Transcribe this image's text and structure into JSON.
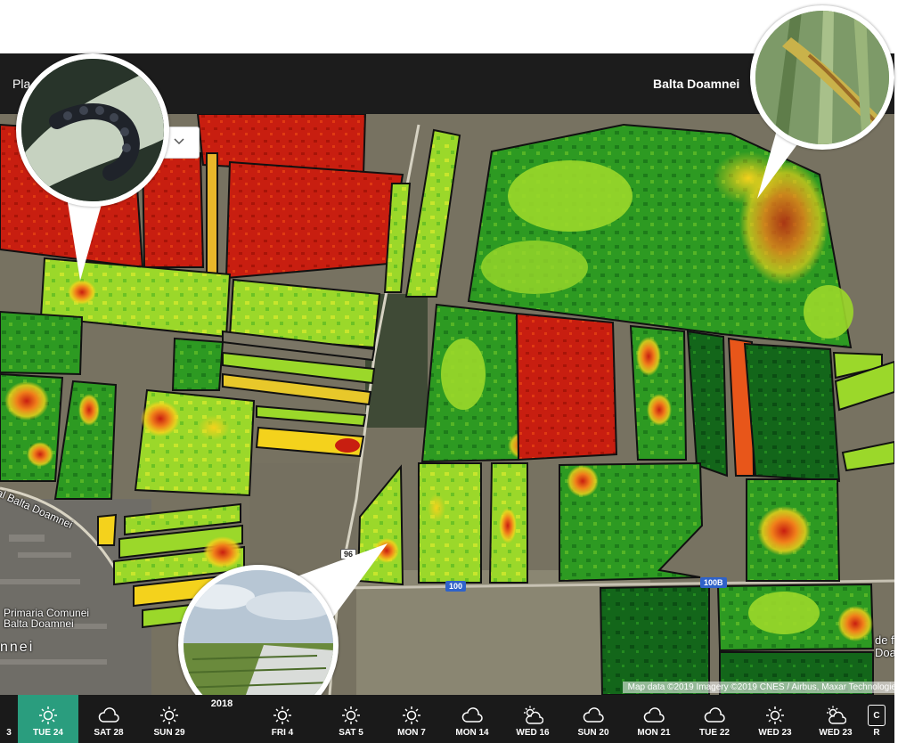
{
  "header": {
    "brand": "Pla",
    "location": "Balta Doamnei"
  },
  "map": {
    "labels": {
      "village_road": "al Balta Doamnei",
      "town_hall": "Primaria Comunei\nBalta Doamnei",
      "town": "nnei",
      "right_edge": "de f\nDoa"
    },
    "roads": [
      "96",
      "100",
      "100B"
    ],
    "attribution": "Map data ©2019 Imagery ©2019 CNES / Airbus, Maxar Technologies"
  },
  "timeline": {
    "year": "2018",
    "days": [
      {
        "label": "3",
        "icon": "sun-icon"
      },
      {
        "label": "TUE 24",
        "icon": "sun-icon",
        "active": true
      },
      {
        "label": "SAT 28",
        "icon": "cloud-icon"
      },
      {
        "label": "SUN 29",
        "icon": "sun-icon"
      },
      {
        "label": "",
        "icon": "",
        "year_marker": true
      },
      {
        "label": "FRI 4",
        "icon": "sun-icon"
      },
      {
        "label": "SAT 5",
        "icon": "sun-icon"
      },
      {
        "label": "MON 7",
        "icon": "sun-icon"
      },
      {
        "label": "MON 14",
        "icon": "cloud-icon"
      },
      {
        "label": "WED 16",
        "icon": "partly-cloudy-icon"
      },
      {
        "label": "SUN 20",
        "icon": "cloud-icon"
      },
      {
        "label": "MON 21",
        "icon": "cloud-icon"
      },
      {
        "label": "TUE 22",
        "icon": "cloud-icon"
      },
      {
        "label": "WED 23",
        "icon": "sun-icon"
      },
      {
        "label": "WED 23",
        "icon": "partly-cloudy-icon"
      }
    ],
    "cut_button": {
      "label": "R",
      "icon_text": "C"
    }
  },
  "colors": {
    "active_day": "#2a9d7e",
    "topbar": "#1c1c1c",
    "timeline": "#1a1a1a",
    "ndvi_low": "#c81e10",
    "ndvi_mid": "#f4d21c",
    "ndvi_high": "#0f6b12"
  }
}
